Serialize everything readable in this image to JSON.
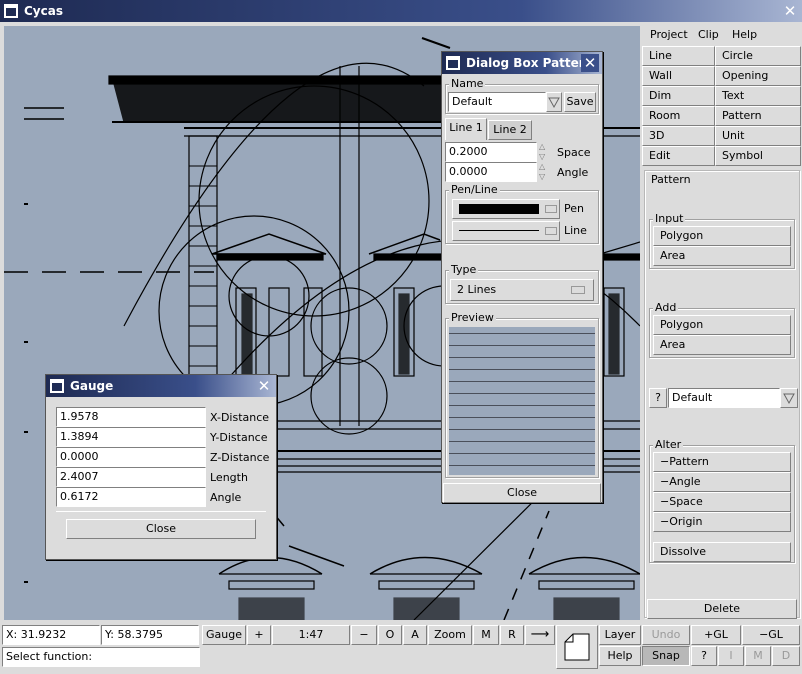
{
  "window": {
    "title": "Cycas"
  },
  "menu": [
    "Project",
    "Clip",
    "Help"
  ],
  "tools": [
    [
      "Line",
      "Circle"
    ],
    [
      "Wall",
      "Opening"
    ],
    [
      "Dim",
      "Text"
    ],
    [
      "Room",
      "Pattern"
    ],
    [
      "3D",
      "Unit"
    ],
    [
      "Edit",
      "Symbol"
    ]
  ],
  "pattern_panel": {
    "title": "Pattern",
    "input": {
      "label": "Input",
      "buttons": [
        "Polygon",
        "Area"
      ]
    },
    "add": {
      "label": "Add",
      "buttons": [
        "Polygon",
        "Area"
      ]
    },
    "help_button": "?",
    "pattern_select": "Default",
    "alter": {
      "label": "Alter",
      "buttons": [
        "−Pattern",
        "−Angle",
        "−Space",
        "−Origin"
      ]
    },
    "dissolve": "Dissolve",
    "delete": "Delete"
  },
  "pattern_dialog": {
    "title": "Dialog Box Pattern",
    "name_label": "Name",
    "name_value": "Default",
    "save": "Save",
    "tabs": [
      "Line 1",
      "Line 2"
    ],
    "space_value": "0.2000",
    "space_label": "Space",
    "angle_value": "0.0000",
    "angle_label": "Angle",
    "penline_label": "Pen/Line",
    "pen_label": "Pen",
    "line_label": "Line",
    "type_label": "Type",
    "type_value": "2 Lines",
    "preview_label": "Preview",
    "close": "Close"
  },
  "gauge": {
    "title": "Gauge",
    "rows": [
      {
        "value": "1.9578",
        "label": "X-Distance"
      },
      {
        "value": "1.3894",
        "label": "Y-Distance"
      },
      {
        "value": "0.0000",
        "label": "Z-Distance"
      },
      {
        "value": "2.4007",
        "label": "Length"
      },
      {
        "value": "0.6172",
        "label": "Angle"
      }
    ],
    "close": "Close"
  },
  "status": {
    "x": "X: 31.9232",
    "y": "Y: 58.3795",
    "gauge": "Gauge",
    "plus": "+",
    "scale": "1:47",
    "minus": "−",
    "o": "O",
    "a": "A",
    "zoom": "Zoom",
    "m": "M",
    "r": "R",
    "arrow": "⟶",
    "layer": "Layer",
    "undo": "Undo",
    "plus_gl": "+GL",
    "minus_gl": "−GL",
    "help": "Help",
    "snap": "Snap",
    "q": "?",
    "i": "I",
    "mm": "M",
    "d": "D",
    "prompt": "Select function:"
  },
  "colors": {
    "canvas": "#9aa8bb",
    "titlebar": "#1e2a52",
    "panel": "#dcdcdc"
  }
}
